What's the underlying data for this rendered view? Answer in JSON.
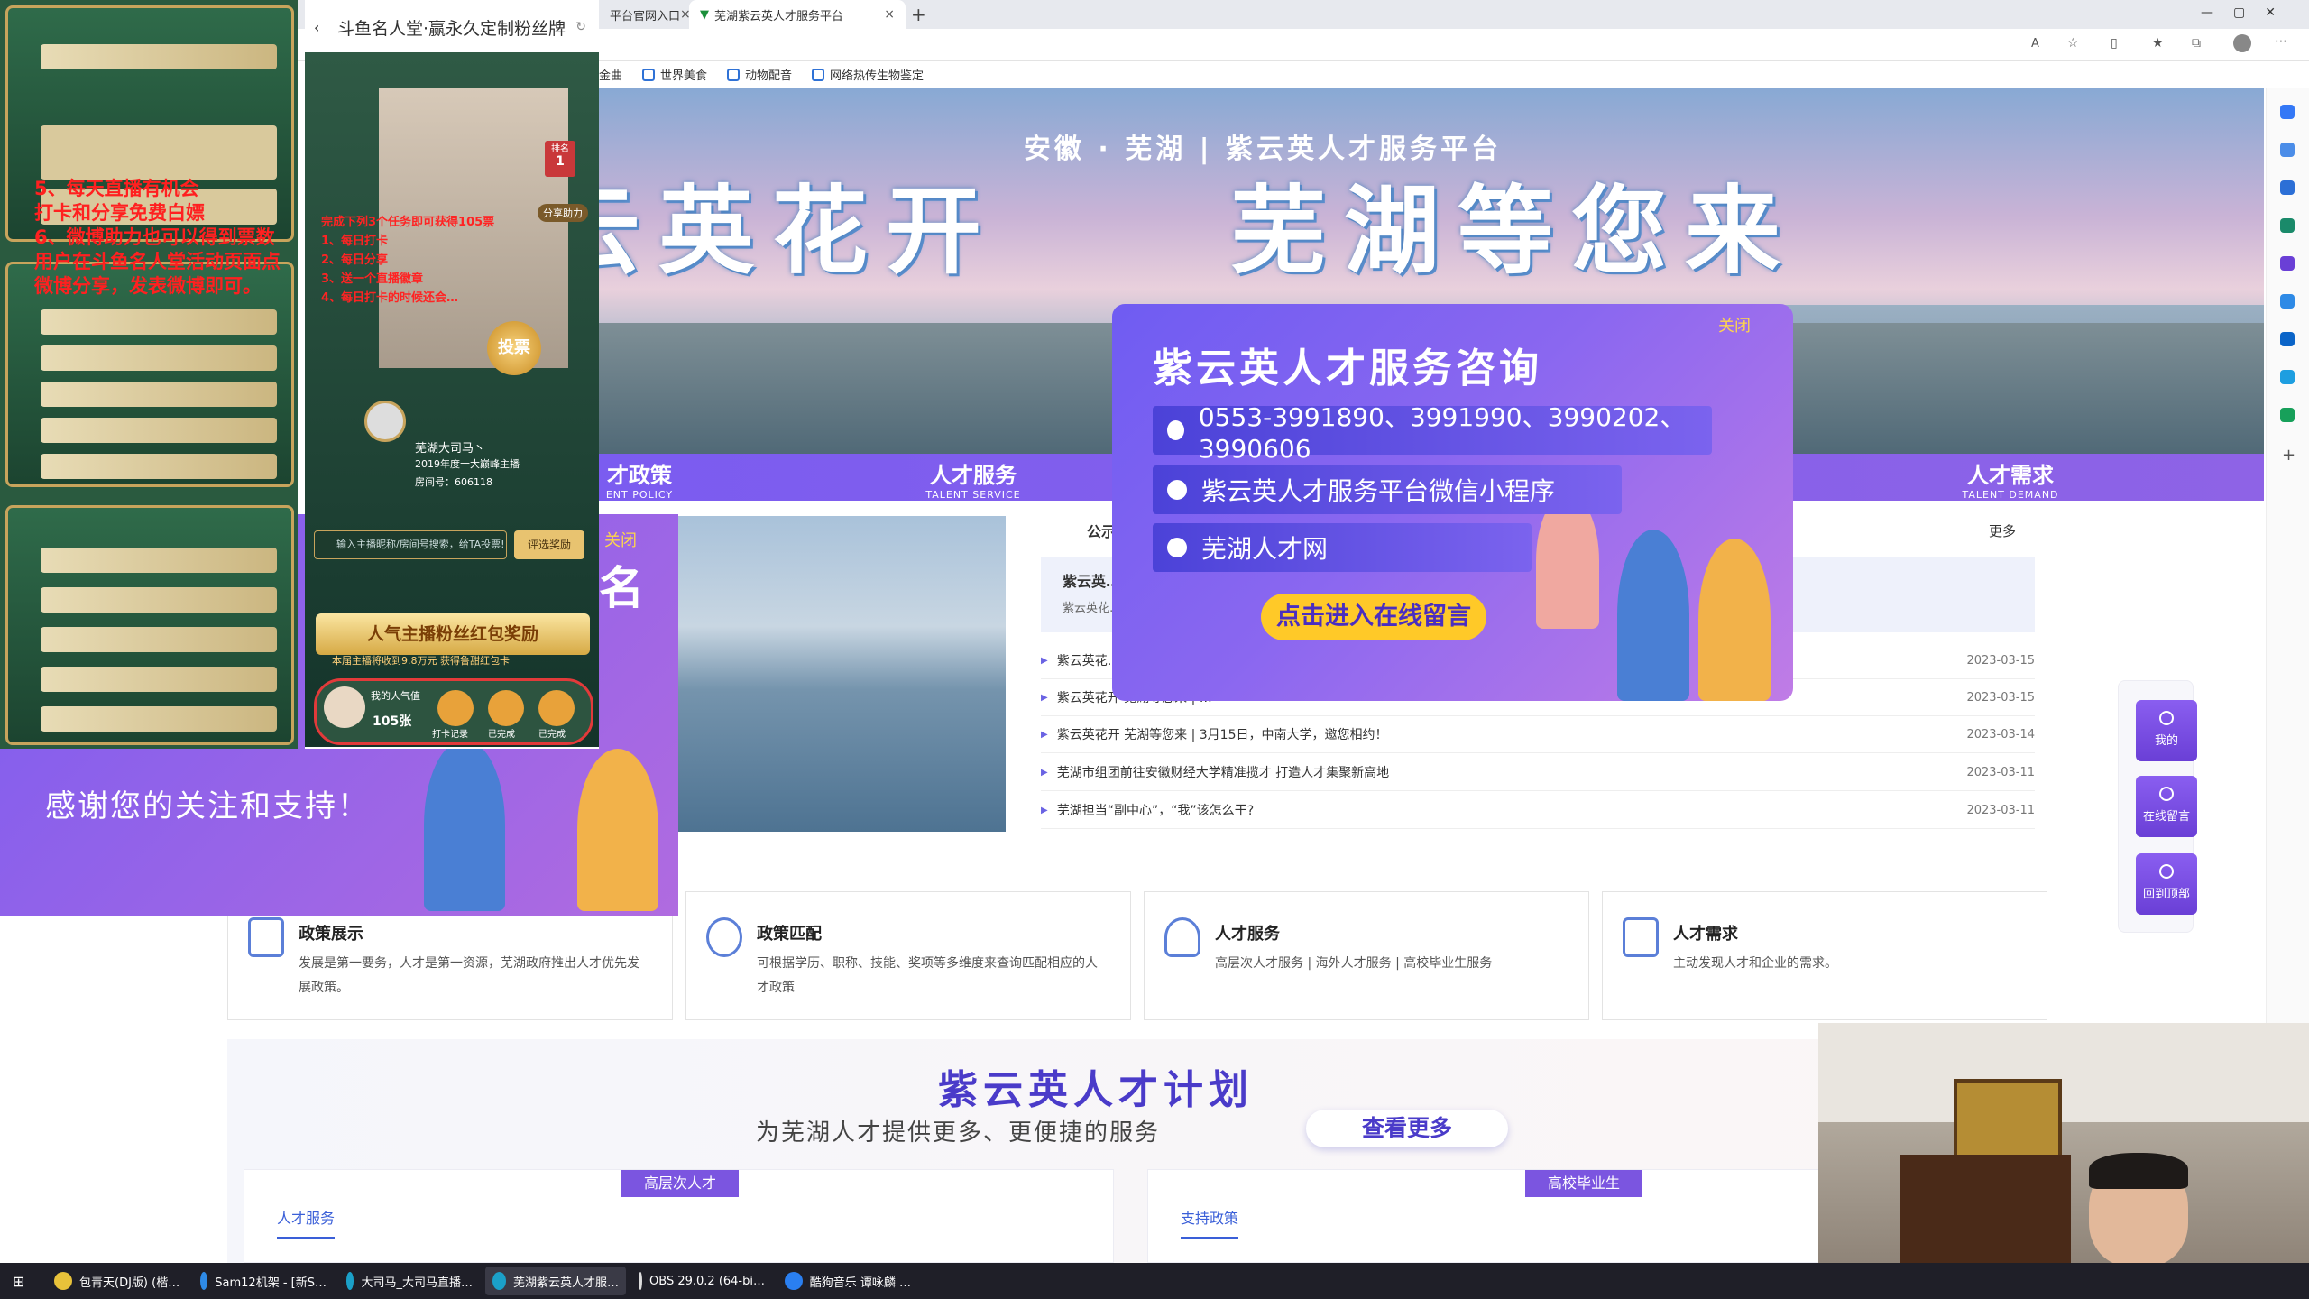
{
  "browser": {
    "tabs": [
      {
        "label": "平台官网入口"
      },
      {
        "label": "芜湖紫云英人才服务平台"
      }
    ],
    "favorites": [
      "金曲",
      "世界美食",
      "动物配音",
      "网络热传生物鉴定"
    ]
  },
  "site": {
    "banner_sub": "安徽 · 芜湖  |  紫云英人才服务平台",
    "banner_main_left": "云英花开",
    "banner_main_right": "芜湖等您来",
    "nav": [
      {
        "title": "才政策",
        "sub": "ENT POLICY"
      },
      {
        "title": "人才服务",
        "sub": "TALENT SERVICE"
      },
      {
        "title": "人才需求",
        "sub": "TALENT DEMAND"
      }
    ],
    "news": {
      "tab": "公示",
      "more": "更多",
      "highlight_title": "紫云英…",
      "highlight_sub": "紫云英花…",
      "rows": [
        {
          "title": "紫云英花…",
          "date": "2023-03-15"
        },
        {
          "title": "紫云英花开 芜湖等您来 | …",
          "date": "2023-03-15"
        },
        {
          "title": "紫云英花开 芜湖等您来 | 3月15日，中南大学，邀您相约！",
          "date": "2023-03-14"
        },
        {
          "title": "芜湖市组团前往安徽财经大学精准揽才 打造人才集聚新高地",
          "date": "2023-03-11"
        },
        {
          "title": "芜湖担当“副中心”，“我”该怎么干?",
          "date": "2023-03-11"
        }
      ]
    },
    "cards": [
      {
        "title": "政策展示",
        "desc": "发展是第一要务，人才是第一资源，芜湖政府推出人才优先发展政策。"
      },
      {
        "title": "政策匹配",
        "desc": "可根据学历、职称、技能、奖项等多维度来查询匹配相应的人才政策"
      },
      {
        "title": "人才服务",
        "desc": "高层次人才服务 | 海外人才服务 | 高校毕业生服务"
      },
      {
        "title": "人才需求",
        "desc": "主动发现人才和企业的需求。"
      }
    ],
    "plan": {
      "title": "紫云英人才计划",
      "subtitle": "为芜湖人才提供更多、更便捷的服务",
      "button": "查看更多",
      "panels": [
        {
          "badge": "高层次人才",
          "tab": "人才服务"
        },
        {
          "badge": "高校毕业生",
          "tab": "支持政策"
        }
      ]
    },
    "float_buttons": [
      "我的",
      "在线留言",
      "回到顶部"
    ],
    "popup": {
      "close": "关闭",
      "title": "紫云英人才服务咨询",
      "phone": "0553-3991890、3991990、3990202、3990606",
      "wechat": "紫云英人才服务平台微信小程序",
      "site": "芜湖人才网",
      "cta": "点击进入在线留言"
    }
  },
  "overlay": {
    "red_text_left": "5、每天直播有机会\n打卡和分享免费白嫖\n6、微博助力也可以得到票数\n用户在斗鱼名人堂活动页面点\n微博分享，发表微博即可。",
    "app_title": "斗鱼名人堂·赢永久定制粉丝牌",
    "rank_label": "排名",
    "rank_value": "1",
    "streamer_name": "芜湖大司马丶",
    "streamer_sub": "2019年度十大巅峰主播",
    "room_no": "房间号：606118",
    "vote": "投票",
    "share": "分享助力",
    "red_task": "完成下列3个任务即可获得105票\n1、每日打卡\n2、每日分享\n3、送一个直播徽章\n4、每日打卡的时候还会…",
    "search_placeholder": "输入主播昵称/房间号搜索，给TA投票!",
    "search_btn": "评选奖励",
    "bottom_banner": "人气主播粉丝红包奖励",
    "bottom_sub": "本届主播将收到9.8万元 获得鲁甜红包卡",
    "my_popularity": "我的人气值",
    "my_count": "105张",
    "f_record": "打卡记录",
    "f_done1": "已完成",
    "f_done2": "已完成",
    "popup2_close": "关闭",
    "popup2_text": "感谢您的关注和支持！",
    "popup2_big": "名"
  },
  "taskbar": [
    "包青天(DJ版) (楷…",
    "Sam12机架 - [新S…",
    "大司马_大司马直播…",
    "芜湖紫云英人才服…",
    "OBS 29.0.2 (64-bi…",
    "酷狗音乐 谭咏麟 …"
  ]
}
